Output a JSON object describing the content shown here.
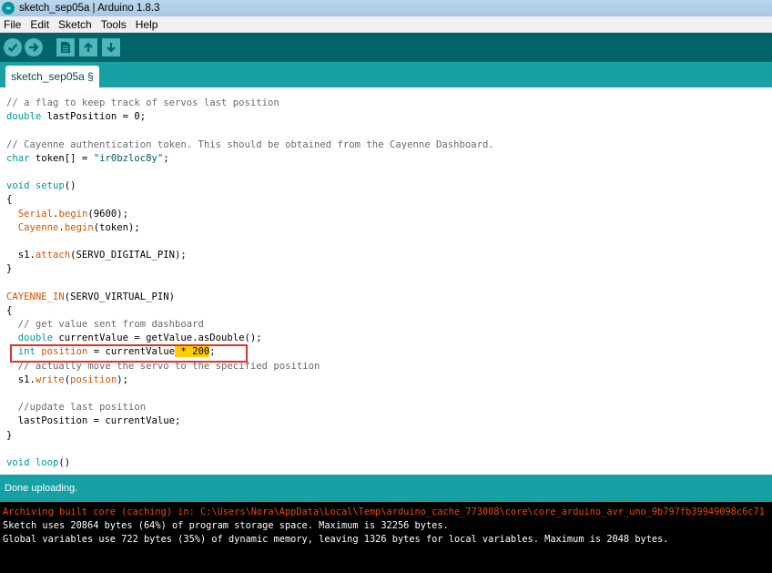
{
  "window": {
    "title": "sketch_sep05a | Arduino 1.8.3",
    "logo_text": "∞"
  },
  "menu": [
    "File",
    "Edit",
    "Sketch",
    "Tools",
    "Help"
  ],
  "toolbar": {
    "buttons": [
      "verify",
      "upload",
      "new",
      "open",
      "save"
    ]
  },
  "tab": {
    "label": "sketch_sep05a §"
  },
  "editor": {
    "lines": [
      [
        [
          "cm",
          "// a flag to keep track of servos last position"
        ]
      ],
      [
        [
          "kw",
          "double"
        ],
        [
          "",
          " lastPosition = 0;"
        ]
      ],
      [
        [
          "",
          ""
        ]
      ],
      [
        [
          "cm",
          "// Cayenne authentication token. This should be obtained from the Cayenne Dashboard."
        ]
      ],
      [
        [
          "kw",
          "char"
        ],
        [
          "",
          " token[] = "
        ],
        [
          "st",
          "\"ir0bzloc8y\""
        ],
        [
          "",
          ";"
        ]
      ],
      [
        [
          "",
          ""
        ]
      ],
      [
        [
          "kw",
          "void"
        ],
        [
          "",
          " "
        ],
        [
          "kw",
          "setup"
        ],
        [
          "",
          "()"
        ]
      ],
      [
        [
          "",
          "{"
        ]
      ],
      [
        [
          "",
          "  "
        ],
        [
          "fn",
          "Serial"
        ],
        [
          "",
          "."
        ],
        [
          "fn",
          "begin"
        ],
        [
          "",
          "(9600);"
        ]
      ],
      [
        [
          "",
          "  "
        ],
        [
          "fn",
          "Cayenne"
        ],
        [
          "",
          "."
        ],
        [
          "fn",
          "begin"
        ],
        [
          "",
          "(token);"
        ]
      ],
      [
        [
          "",
          ""
        ]
      ],
      [
        [
          "",
          "  s1."
        ],
        [
          "fn",
          "attach"
        ],
        [
          "",
          "(SERVO_DIGITAL_PIN);"
        ]
      ],
      [
        [
          "",
          "}"
        ]
      ],
      [
        [
          "",
          ""
        ]
      ],
      [
        [
          "fn",
          "CAYENNE_IN"
        ],
        [
          "",
          "(SERVO_VIRTUAL_PIN)"
        ]
      ],
      [
        [
          "",
          "{"
        ]
      ],
      [
        [
          "cm",
          "  // get value sent from dashboard"
        ]
      ],
      [
        [
          "",
          "  "
        ],
        [
          "kw",
          "double"
        ],
        [
          "",
          " currentValue = getValue.asDouble();"
        ]
      ],
      [
        [
          "",
          "  "
        ],
        [
          "kw",
          "int"
        ],
        [
          "",
          " "
        ],
        [
          "fn",
          "position"
        ],
        [
          "",
          " = currentValue"
        ],
        [
          "hl",
          " * 200"
        ],
        [
          "",
          ";"
        ]
      ],
      [
        [
          "cm",
          "  // actually move the servo to the specified position"
        ]
      ],
      [
        [
          "",
          "  s1."
        ],
        [
          "fn",
          "write"
        ],
        [
          "",
          "("
        ],
        [
          "fn",
          "position"
        ],
        [
          "",
          ");"
        ]
      ],
      [
        [
          "",
          ""
        ]
      ],
      [
        [
          "cm",
          "  //update last position"
        ]
      ],
      [
        [
          "",
          "  lastPosition = currentValue;"
        ]
      ],
      [
        [
          "",
          "}"
        ]
      ],
      [
        [
          "",
          ""
        ]
      ],
      [
        [
          "kw",
          "void"
        ],
        [
          "",
          " "
        ],
        [
          "kw",
          "loop"
        ],
        [
          "",
          "()"
        ]
      ]
    ]
  },
  "status": {
    "text": "Done uploading."
  },
  "console": {
    "lines": [
      {
        "color": "orange",
        "text": "Archiving built core (caching) in: C:\\Users\\Nora\\AppData\\Local\\Temp\\arduino_cache_773008\\core\\core_arduino_avr_uno_9b797fb39949098c6c71"
      },
      {
        "color": "white",
        "text": "Sketch uses 20864 bytes (64%) of program storage space. Maximum is 32256 bytes."
      },
      {
        "color": "white",
        "text": "Global variables use 722 bytes (35%) of dynamic memory, leaving 1326 bytes for local variables. Maximum is 2048 bytes."
      }
    ]
  },
  "colors": {
    "toolbar": "#006468",
    "accent": "#17a1a5",
    "button": "#4db7bb",
    "highlight": "#ffcc00",
    "annotation": "#e0312b"
  }
}
